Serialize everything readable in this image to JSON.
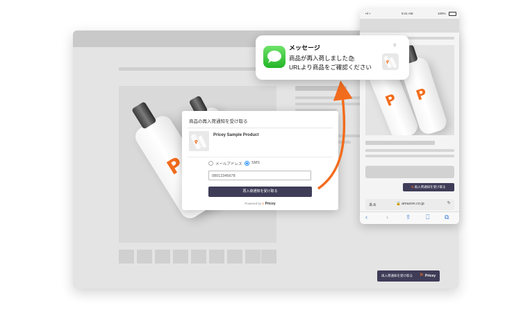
{
  "modal": {
    "title": "商品の再入荷通知を受け取る",
    "product_name": "Pricey Sample Product",
    "option_email": "メールアドレス",
    "option_sms": "SMS",
    "selected": "SMS",
    "phone_value": "08012345678",
    "submit_label": "再入荷通知を受け取る",
    "powered_by": "Powered by",
    "brand": "Pricey"
  },
  "desktop": {
    "float_button_label": "再入荷通知を受け取る",
    "float_brand": "Pricey"
  },
  "phone": {
    "status_time": "9:41 AM",
    "status_battery": "100%",
    "notify_button_label": "再入荷通知を受け取る",
    "url_left": "あぁ",
    "url": "amazon.co.jp"
  },
  "notification": {
    "app": "メッセージ",
    "line1": "商品が再入荷しました",
    "line2": "URLより商品をご確認ください"
  },
  "colors": {
    "accent_orange": "#f26c1d",
    "button_dark": "#3f3c58",
    "sms_blue": "#1e90ff",
    "messages_green": "#2fc12f"
  }
}
